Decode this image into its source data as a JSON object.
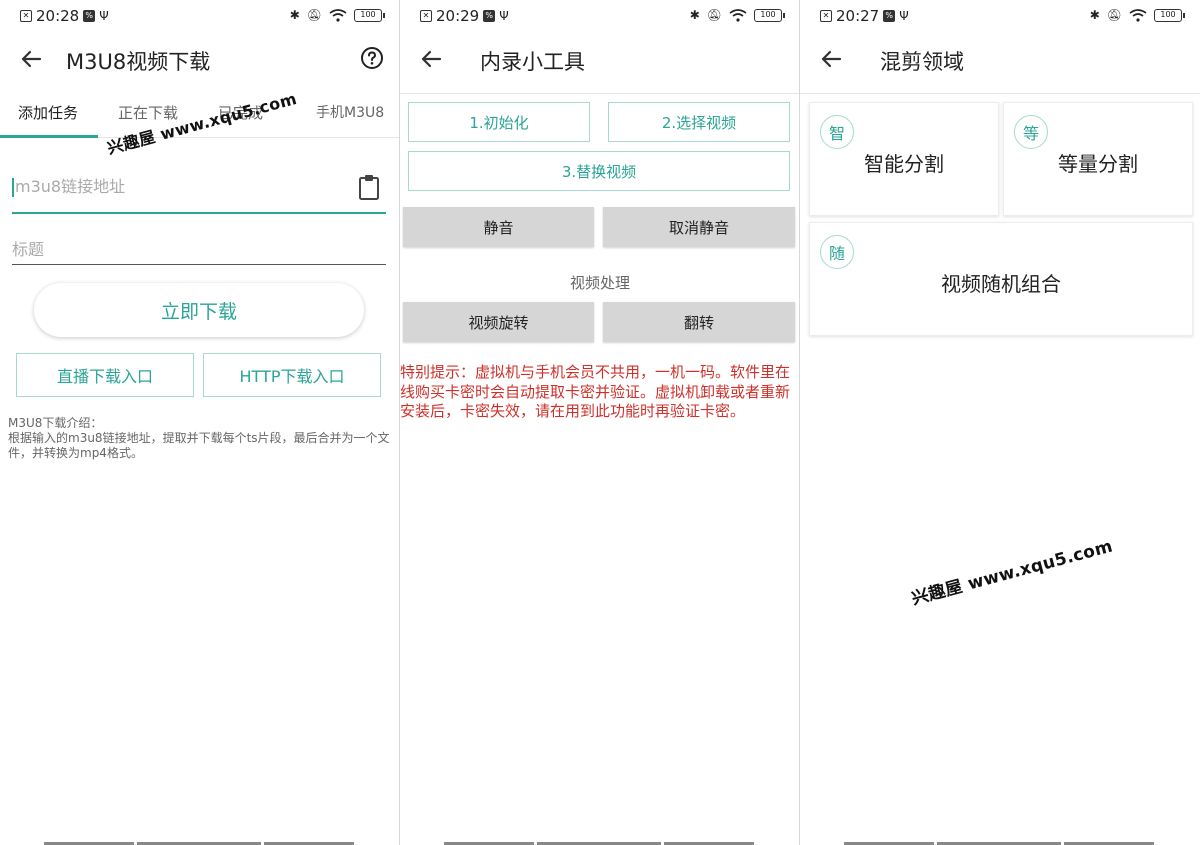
{
  "panel1": {
    "status": {
      "time": "20:28",
      "battery": "100"
    },
    "title": "M3U8视频下载",
    "tabs": [
      "添加任务",
      "正在下载",
      "已完成",
      "手机M3U8"
    ],
    "watermark": "兴趣屋 www.xqu5.com",
    "url_placeholder": "m3u8链接地址",
    "title_placeholder": "标题",
    "download_button": "立即下载",
    "live_button": "直播下载入口",
    "http_button": "HTTP下载入口",
    "intro_title": "M3U8下载介绍：",
    "intro_body": "根据输入的m3u8链接地址，提取并下载每个ts片段，最后合并为一个文件，并转换为mp4格式。"
  },
  "panel2": {
    "status": {
      "time": "20:29",
      "battery": "100"
    },
    "title": "内录小工具",
    "btn_init": "1.初始化",
    "btn_select": "2.选择视频",
    "btn_replace": "3.替换视频",
    "btn_mute": "静音",
    "btn_unmute": "取消静音",
    "section_label": "视频处理",
    "btn_rotate": "视频旋转",
    "btn_flip": "翻转",
    "notice": "特别提示：虚拟机与手机会员不共用，一机一码。软件里在线购买卡密时会自动提取卡密并验证。虚拟机卸载或者重新安装后，卡密失效，请在用到此功能时再验证卡密。"
  },
  "panel3": {
    "status": {
      "time": "20:27",
      "battery": "100"
    },
    "title": "混剪领域",
    "cards": [
      {
        "badge": "智",
        "label": "智能分割"
      },
      {
        "badge": "等",
        "label": "等量分割"
      },
      {
        "badge": "随",
        "label": "视频随机组合"
      }
    ],
    "watermark": "兴趣屋 www.xqu5.com"
  },
  "colors": {
    "accent": "#2aa596",
    "warning": "#d0302a",
    "gray_button": "#d6d6d6"
  },
  "icons": [
    "back-arrow-icon",
    "help-circle-icon",
    "clipboard-icon",
    "bluetooth-icon",
    "mute-bell-icon",
    "wifi-icon",
    "battery-icon"
  ]
}
